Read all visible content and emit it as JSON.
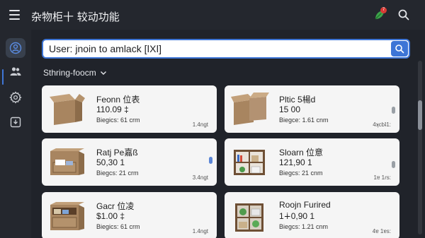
{
  "header": {
    "title": "杂物柜十 较动功能",
    "menu_icon": "hamburger-menu-icon",
    "extension_icon": "leaf-extension-icon",
    "notification_count": "7",
    "search_icon": "search-icon"
  },
  "sidebar": {
    "items": [
      {
        "icon": "user-profile-icon",
        "active": true
      },
      {
        "icon": "users-group-icon",
        "active": false
      },
      {
        "icon": "gear-settings-icon",
        "active": false
      },
      {
        "icon": "download-box-icon",
        "active": false
      }
    ]
  },
  "search": {
    "value": "User: jnoin to amlack [ǀXǀ]",
    "submit_icon": "search-icon"
  },
  "sort": {
    "label": "Sthring-foocm",
    "chevron": "chevron-down-icon"
  },
  "products": [
    {
      "name": "Feonn 位表",
      "price": "110.09 ‡",
      "meta": "Biegics: 61 crm",
      "tag": "1.4ngt",
      "image": "open-cardboard-box",
      "handle": false
    },
    {
      "name": "Pltic 5楊d",
      "price": "15 00",
      "meta": "Biegce: 1.61 cnm",
      "tag": "4ʞcbʇ1:",
      "image": "stacked-cardboard-boxes",
      "handle": true
    },
    {
      "name": "Ratj Pe嘉ß",
      "price": "50,30 1",
      "meta": "Biegcs: 21 crm",
      "tag": "3.4ngt",
      "image": "drawer-storage-box",
      "handle": true
    },
    {
      "name": "Sloarn 位意",
      "price": "121,90 1",
      "meta": "Biegcs: 21 cnm",
      "tag": "1ɐ 1ɾs:",
      "image": "cubby-shelf-with-items",
      "handle": true
    },
    {
      "name": "Gacr 位凌",
      "price": "$1.00 ‡",
      "meta": "Biegics: 61 crm",
      "tag": "1.4ngt",
      "image": "open-drawer-cabinet",
      "handle": false
    },
    {
      "name": "Roojn Furired",
      "price": "1∔0,90 1",
      "meta": "Biegcs: 1.21 cnm",
      "tag": "4ɐ 1ɐs:",
      "image": "cube-shelf-with-plants",
      "handle": false
    }
  ],
  "colors": {
    "background": "#20232a",
    "accent": "#3d75d6",
    "card": "#f5f5f5",
    "badge": "#d83a34"
  }
}
